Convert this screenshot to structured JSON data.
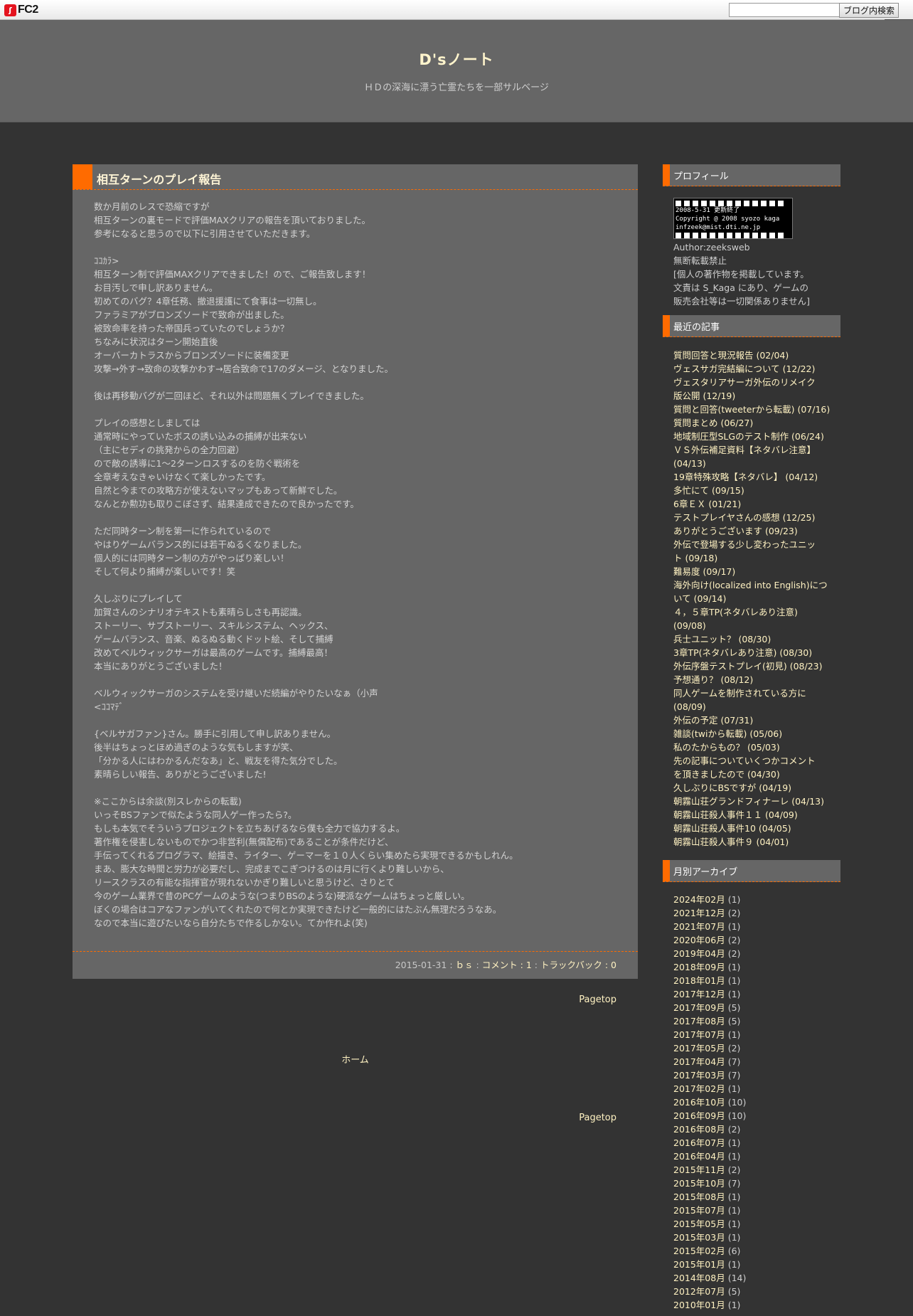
{
  "fc2": {
    "logo": "FC2",
    "search_placeholder": "",
    "search_button": "ブログ内検索"
  },
  "site": {
    "title": "D'sノート",
    "description": "ＨＤの深海に漂う亡霊たちを一部サルベージ"
  },
  "entry": {
    "title": "相互ターンのプレイ報告",
    "paragraphs": [
      [
        "数か月前のレスで恐縮ですが",
        "相互ターンの裏モードで評価MAXクリアの報告を頂いておりました。",
        "参考になると思うので以下に引用させていただきます。"
      ],
      [
        "ｺｺｶﾗ>",
        "相互ターン制で評価MAXクリアできました！ので、ご報告致します！",
        "お目汚しで申し訳ありません。",
        "初めてのバグ？4章任務、撤退援護にて食事は一切無し。",
        "ファラミアがブロンズソードで致命が出ました。",
        "被致命率を持った帝国兵っていたのでしょうか？",
        "ちなみに状況はターン開始直後",
        "オーバーカトラスからブロンズソードに装備変更",
        "攻撃→外す→致命の攻撃かわす→居合致命で17のダメージ、となりました。"
      ],
      [
        "後は再移動バグが二回ほど、それ以外は問題無くプレイできました。"
      ],
      [
        "プレイの感想としましては",
        "通常時にやっていたボスの誘い込みの捕縛が出来ない",
        "（主にセディの挑発からの全力回避）",
        "ので敵の誘導に1〜2ターンロスするのを防ぐ戦術を",
        "全章考えなきゃいけなくて楽しかったです。",
        "自然と今までの攻略方が使えないマップもあって新鮮でした。",
        "なんとか勲功も取りこぼさず、結果達成できたので良かったです。"
      ],
      [
        "ただ同時ターン制を第一に作られているので",
        "やはりゲームバランス的には若干ぬるくなりました。",
        "個人的には同時ターン制の方がやっぱり楽しい！",
        "そして何より捕縛が楽しいです！笑"
      ],
      [
        "久しぶりにプレイして",
        "加賀さんのシナリオテキストも素晴らしさも再認識。",
        "ストーリー、サブストーリー、スキルシステム、ヘックス、",
        "ゲームバランス、音楽、ぬるぬる動くドット絵、そして捕縛",
        "改めてベルウィックサーガは最高のゲームです。捕縛最高！",
        "本当にありがとうございました！"
      ],
      [
        "ベルウィックサーガのシステムを受け継いだ続編がやりたいなぁ（小声",
        "<ｺｺﾏﾃﾞ"
      ],
      [
        "{ベルサガファン}さん。勝手に引用して申し訳ありません。",
        "後半はちょっとほめ過ぎのような気もしますが笑、",
        "「分かる人にはわかるんだなあ」と、戦友を得た気分でした。",
        "素晴らしい報告、ありがとうございました!"
      ],
      [
        "※ここからは余談(別スレからの転載)",
        "いっそBSファンで似たような同人ゲー作ったら?。",
        "もしも本気でそういうプロジェクトを立ちあげるなら僕も全力で協力するよ。",
        "著作権を侵害しないものでかつ非営利(無償配布)であることが条件だけど、",
        "手伝ってくれるプログラマ、絵描き、ライター、ゲーマーを１０人くらい集めたら実現できるかもしれん。",
        "まあ、膨大な時間と労力が必要だし、完成までこぎつけるのは月に行くより難しいから、",
        "リースクラスの有能な指揮官が現れないかぎり難しいと思うけど、さりとて",
        "今のゲーム業界で昔のPCゲームのような(つまりBSのような)硬派なゲームはちょっと厳しい。",
        "ぼくの場合はコアなファンがいてくれたので何とか実現できたけど一般的にはたぶん無理だろうなあ。",
        "なので本当に遊びたいなら自分たちで作るしかない。てか作れよ(笑)"
      ]
    ],
    "footer": {
      "date": "2015-01-31",
      "sep": " : ",
      "category": "ｂｓ",
      "comment": "コメント : 1",
      "trackback": "トラックバック : 0"
    }
  },
  "nav": {
    "pagetop": "Pagetop",
    "home": "ホーム"
  },
  "sidebar": {
    "profile": {
      "title": "プロフィール",
      "image_lines": [
        "2008-5-31 更新終了",
        "Copyright @ 2008 syozo kaga",
        "infzeek@mist.dti.ne.jp"
      ],
      "lines": [
        "Author:zeeksweb",
        "無断転載禁止",
        "[個人の著作物を掲載しています。",
        "文責は S_Kaga にあり、ゲームの",
        "販売会社等は一切関係ありません]"
      ]
    },
    "recent": {
      "title": "最近の記事",
      "items": [
        [
          "質問回答と現況報告 (02/04)"
        ],
        [
          "ヴェスサガ完結編について (12/22)"
        ],
        [
          "ヴェスタリアサーガ外伝のリメイク",
          "版公開 (12/19)"
        ],
        [
          "質問と回答(tweeterから転載) (07/16)"
        ],
        [
          "質問まとめ (06/27)"
        ],
        [
          "地域制圧型SLGのテスト制作 (06/24)"
        ],
        [
          "ＶＳ外伝補足資料【ネタバレ注意】",
          "(04/13)"
        ],
        [
          "19章特殊攻略【ネタバレ】 (04/12)"
        ],
        [
          "多忙にて (09/15)"
        ],
        [
          "6章ＥＸ (01/21)"
        ],
        [
          "テストプレイヤさんの感想 (12/25)"
        ],
        [
          "ありがとうございます (09/23)"
        ],
        [
          "外伝で登場する少し変わったユニッ",
          "ト (09/18)"
        ],
        [
          "難易度 (09/17)"
        ],
        [
          "海外向け(localized into English)につ",
          "いて (09/14)"
        ],
        [
          "４，５章TP(ネタバレあり注意)",
          "(09/08)"
        ],
        [
          "兵士ユニット？ (08/30)"
        ],
        [
          "3章TP(ネタバレあり注意) (08/30)"
        ],
        [
          "外伝序盤テストプレイ(初見) (08/23)"
        ],
        [
          "予想通り？ (08/12)"
        ],
        [
          "同人ゲームを制作されている方に",
          "(08/09)"
        ],
        [
          "外伝の予定 (07/31)"
        ],
        [
          "雑談(twiから転載) (05/06)"
        ],
        [
          "私のたからもの？ (05/03)"
        ],
        [
          "先の記事についていくつかコメント",
          "を頂きましたので (04/30)"
        ],
        [
          "久しぶりにBSですが (04/19)"
        ],
        [
          "朝霧山荘グランドフィナーレ (04/13)"
        ],
        [
          "朝霧山荘殺人事件１１ (04/09)"
        ],
        [
          "朝霧山荘殺人事件10 (04/05)"
        ],
        [
          "朝霧山荘殺人事件９ (04/01)"
        ]
      ]
    },
    "archive": {
      "title": "月別アーカイブ",
      "items": [
        {
          "month": "2024年02月",
          "count": " (1)"
        },
        {
          "month": "2021年12月",
          "count": " (2)"
        },
        {
          "month": "2021年07月",
          "count": " (1)"
        },
        {
          "month": "2020年06月",
          "count": " (2)"
        },
        {
          "month": "2019年04月",
          "count": " (2)"
        },
        {
          "month": "2018年09月",
          "count": " (1)"
        },
        {
          "month": "2018年01月",
          "count": " (1)"
        },
        {
          "month": "2017年12月",
          "count": " (1)"
        },
        {
          "month": "2017年09月",
          "count": " (5)"
        },
        {
          "month": "2017年08月",
          "count": " (5)"
        },
        {
          "month": "2017年07月",
          "count": " (1)"
        },
        {
          "month": "2017年05月",
          "count": " (2)"
        },
        {
          "month": "2017年04月",
          "count": " (7)"
        },
        {
          "month": "2017年03月",
          "count": " (7)"
        },
        {
          "month": "2017年02月",
          "count": " (1)"
        },
        {
          "month": "2016年10月",
          "count": " (10)"
        },
        {
          "month": "2016年09月",
          "count": " (10)"
        },
        {
          "month": "2016年08月",
          "count": " (2)"
        },
        {
          "month": "2016年07月",
          "count": " (1)"
        },
        {
          "month": "2016年04月",
          "count": " (1)"
        },
        {
          "month": "2015年11月",
          "count": " (2)"
        },
        {
          "month": "2015年10月",
          "count": " (7)"
        },
        {
          "month": "2015年08月",
          "count": " (1)"
        },
        {
          "month": "2015年07月",
          "count": " (1)"
        },
        {
          "month": "2015年05月",
          "count": " (1)"
        },
        {
          "month": "2015年03月",
          "count": " (1)"
        },
        {
          "month": "2015年02月",
          "count": " (6)"
        },
        {
          "month": "2015年01月",
          "count": " (1)"
        },
        {
          "month": "2014年08月",
          "count": " (14)"
        },
        {
          "month": "2012年07月",
          "count": " (5)"
        },
        {
          "month": "2010年01月",
          "count": " (1)"
        }
      ]
    }
  }
}
